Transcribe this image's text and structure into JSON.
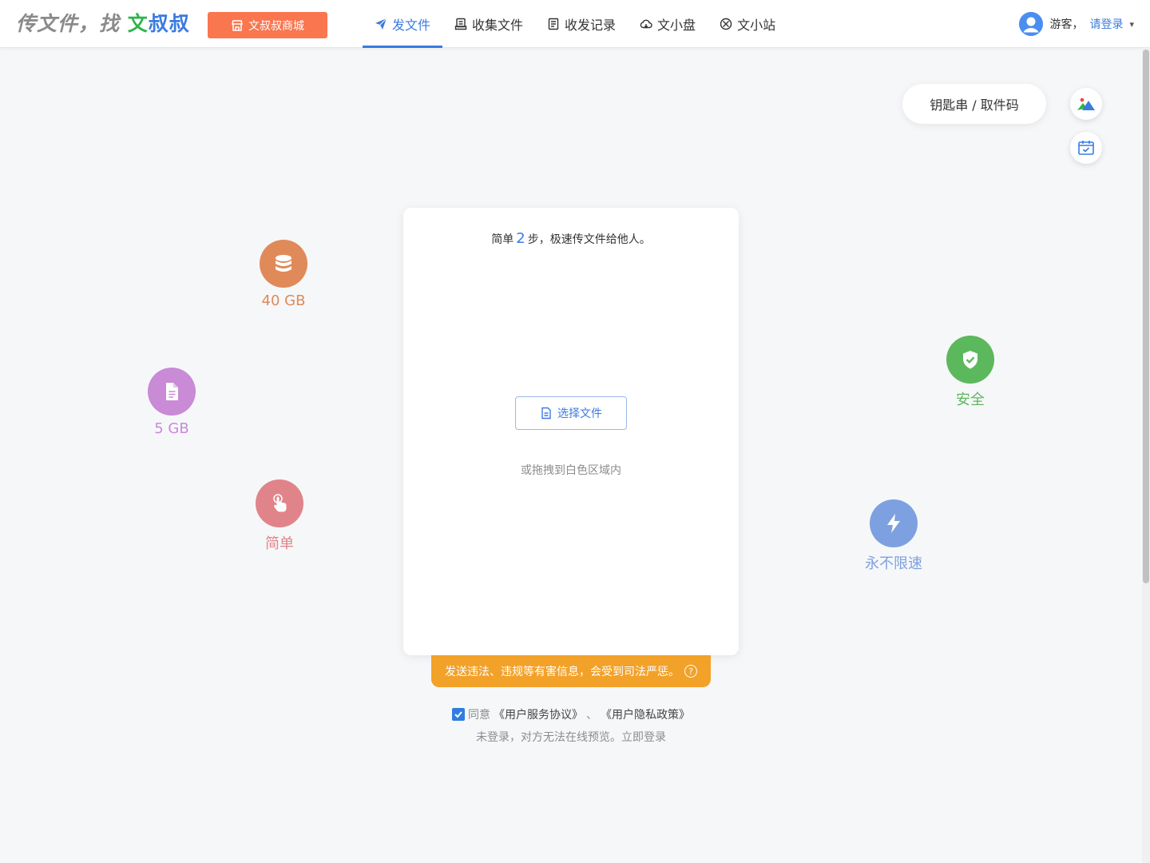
{
  "header": {
    "logo_prefix": "传文件，找",
    "logo_brand_first": "文",
    "logo_brand_rest": "叔叔",
    "shop_label": "文叔叔商城",
    "nav": [
      {
        "label": "发文件",
        "icon": "paper-plane-icon",
        "active": true
      },
      {
        "label": "收集文件",
        "icon": "inbox-icon",
        "active": false
      },
      {
        "label": "收发记录",
        "icon": "record-icon",
        "active": false
      },
      {
        "label": "文小盘",
        "icon": "cloud-drive-icon",
        "active": false
      },
      {
        "label": "文小站",
        "icon": "site-icon",
        "active": false
      }
    ],
    "user": {
      "guest_label": "游客，",
      "login_label": "请登录",
      "caret": "▾"
    }
  },
  "tools": {
    "key_pill_label": "钥匙串 / 取件码",
    "icons": [
      "image-icon",
      "calendar-check-icon"
    ]
  },
  "features": {
    "storage": {
      "label": "40 GB",
      "color": "#e08a5a",
      "icon": "database-icon"
    },
    "file_size": {
      "label": "5 GB",
      "color": "#c98ad6",
      "icon": "file-icon"
    },
    "simple": {
      "label": "简单",
      "color": "#e0848a",
      "icon": "hand-pointer-icon"
    },
    "secure": {
      "label": "安全",
      "color": "#5cb85c",
      "icon": "shield-check-icon"
    },
    "speed": {
      "label": "永不限速",
      "color": "#7da1e0",
      "icon": "lightning-icon"
    }
  },
  "card": {
    "tagline_before": "简单",
    "tagline_num": "2",
    "tagline_after": "步，极速传文件给他人。",
    "choose_label": "选择文件",
    "drag_hint": "或拖拽到白色区域内"
  },
  "warning": {
    "text": "发送违法、违规等有害信息，会受到司法严惩。",
    "help": "?"
  },
  "agreement": {
    "agree_label": "同意",
    "terms": "《用户服务协议》",
    "separator": "、",
    "privacy": "《用户隐私政策》",
    "notice": "未登录，对方无法在线预览。",
    "login_now": "立即登录"
  },
  "colors": {
    "accent": "#3a7be0",
    "shop": "#f9764f",
    "warning": "#f2a129",
    "logo_green": "#2db54a"
  }
}
